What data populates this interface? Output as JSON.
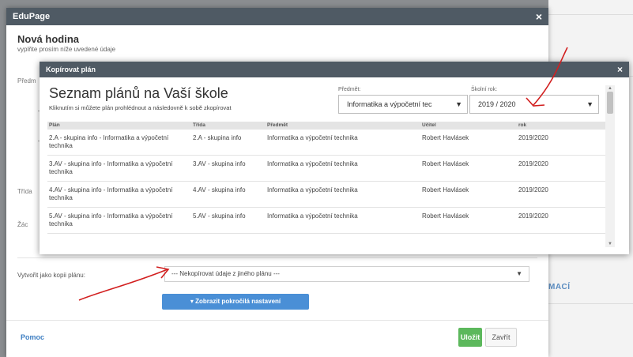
{
  "background": {
    "right_text": "MACÍ"
  },
  "outer_modal": {
    "app_title": "EduPage",
    "close_glyph": "×",
    "title": "Nová hodina",
    "subtitle": "vyplňte prosím níže uvedené údaje",
    "cut_label_1": "Předm",
    "cut_label_2": "Třída",
    "cut_label_3": "Žác",
    "copy_label": "Vytvořit jako kopii plánu:",
    "copy_select_value": "--- Nekopírovat údaje z jiného plánu ---",
    "advanced_button": "▾ Zobrazit pokročilá nastavení",
    "help_link": "Pomoc",
    "save_button": "Uložit",
    "close_button": "Zavřít"
  },
  "inner_modal": {
    "header": "Kopírovat plán",
    "close_glyph": "×",
    "title": "Seznam plánů na Vaší škole",
    "subtitle": "Kliknutím si můžete plán prohlédnout a následovně k sobě zkopírovat",
    "subject_label": "Předmět:",
    "subject_value": "Informatika a výpočetní tec",
    "year_label": "Školní rok:",
    "year_value": "2019 / 2020",
    "columns": [
      "Plán",
      "Třída",
      "Předmět",
      "Učitel",
      "rok"
    ],
    "rows": [
      {
        "plan": "2.A - skupina info - Informatika a výpočetní technika",
        "trida": "2.A - skupina info",
        "predmet": "Informatika a výpočetní technika",
        "ucitel": "Robert Havlásek",
        "rok": "2019/2020"
      },
      {
        "plan": "3.AV - skupina info - Informatika a výpočetní technika",
        "trida": "3.AV - skupina info",
        "predmet": "Informatika a výpočetní technika",
        "ucitel": "Robert Havlásek",
        "rok": "2019/2020"
      },
      {
        "plan": "4.AV - skupina info - Informatika a výpočetní technika",
        "trida": "4.AV - skupina info",
        "predmet": "Informatika a výpočetní technika",
        "ucitel": "Robert Havlásek",
        "rok": "2019/2020"
      },
      {
        "plan": "5.AV - skupina info - Informatika a výpočetní technika",
        "trida": "5.AV - skupina info",
        "predmet": "Informatika a výpočetní technika",
        "ucitel": "Robert Havlásek",
        "rok": "2019/2020"
      }
    ]
  },
  "colors": {
    "header_bg": "#4f5a64",
    "primary_button": "#4a8fd6",
    "save_button": "#5cb85c",
    "annotation": "#d21f1f"
  }
}
